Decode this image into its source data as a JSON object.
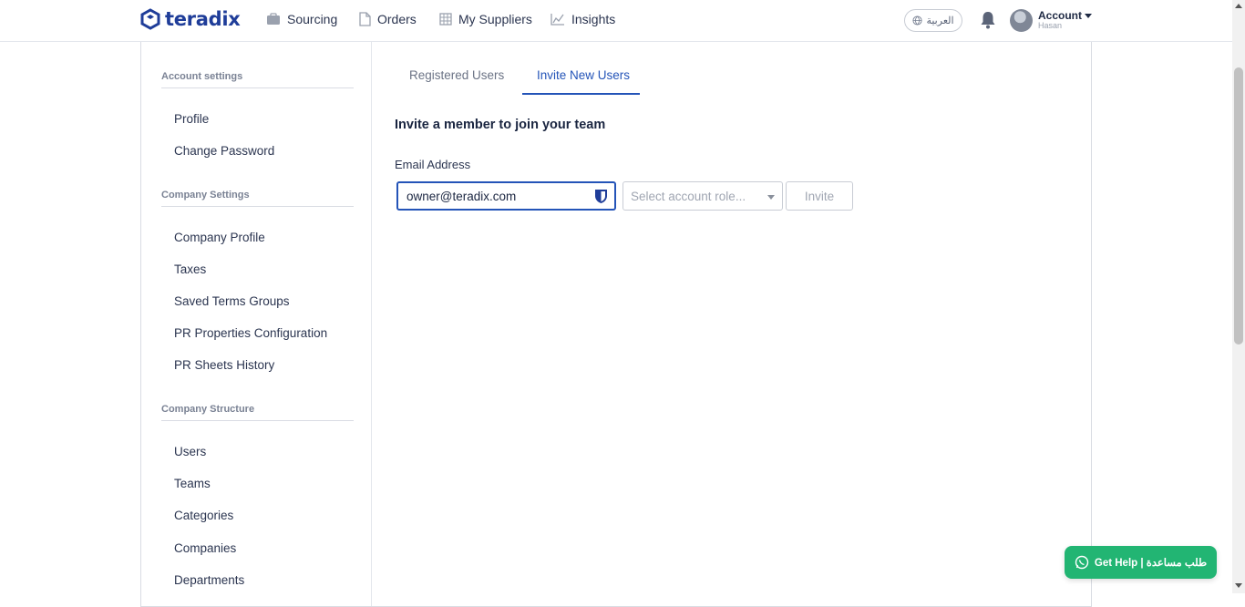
{
  "brand": {
    "name": "teradix",
    "color": "#1f3d99"
  },
  "nav": {
    "items": [
      {
        "label": "Sourcing",
        "icon": "briefcase-icon"
      },
      {
        "label": "Orders",
        "icon": "document-icon"
      },
      {
        "label": "My Suppliers",
        "icon": "building-icon"
      },
      {
        "label": "Insights",
        "icon": "chart-line-icon"
      }
    ],
    "language": "العربية",
    "account_label": "Account",
    "account_user": "Hasan"
  },
  "sidebar": {
    "account_settings": "Account settings",
    "profile": "Profile",
    "change_password": "Change Password",
    "company_settings": "Company Settings",
    "company_profile": "Company Profile",
    "taxes": "Taxes",
    "saved_terms_groups": "Saved Terms Groups",
    "pr_properties_configuration": "PR Properties Configuration",
    "pr_sheets_history": "PR Sheets History",
    "company_structure": "Company Structure",
    "users": "Users",
    "teams": "Teams",
    "categories": "Categories",
    "companies": "Companies",
    "departments": "Departments"
  },
  "tabs": {
    "registered": "Registered Users",
    "invite": "Invite New Users"
  },
  "invite_form": {
    "heading": "Invite a member to join your team",
    "email_label": "Email Address",
    "email_value": "owner@teradix.com",
    "role_placeholder": "Select account role...",
    "invite_label": "Invite"
  },
  "help": {
    "label": "Get Help | طلب مساعدة"
  },
  "colors": {
    "accent": "#2454b8",
    "help_green": "#22b573"
  }
}
